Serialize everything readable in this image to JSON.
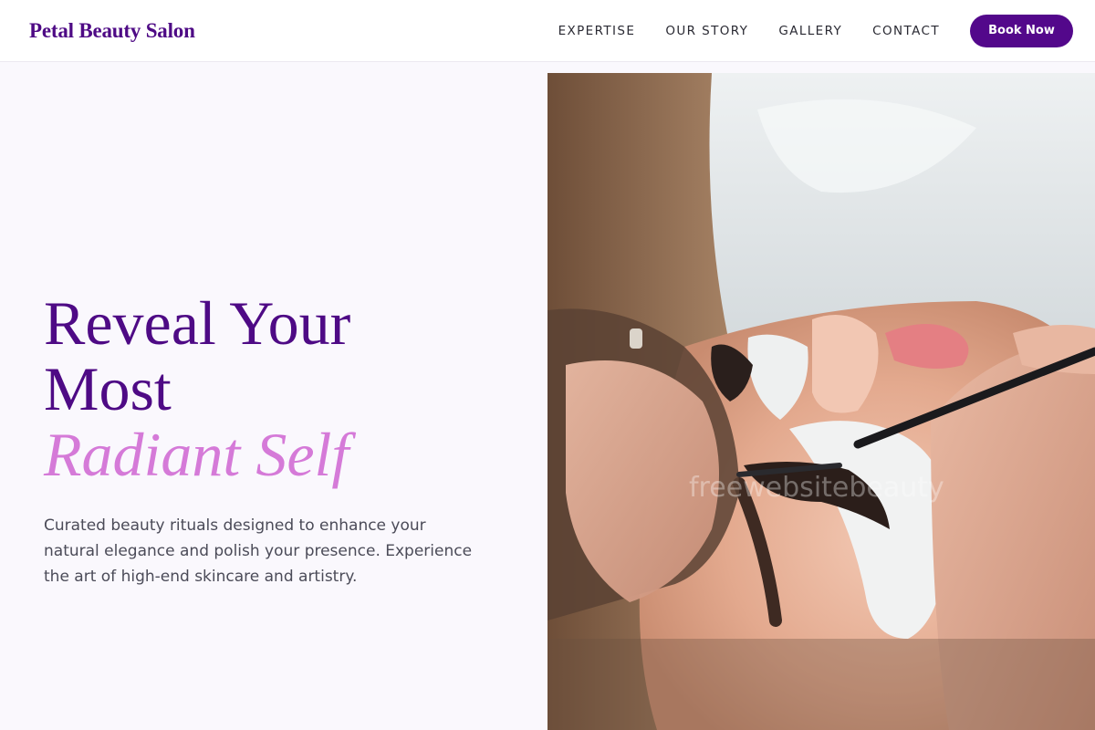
{
  "header": {
    "brand": "Petal Beauty Salon",
    "nav": [
      "EXPERTISE",
      "OUR STORY",
      "GALLERY",
      "CONTACT"
    ],
    "cta": "Book Now"
  },
  "hero": {
    "title_line1": "Reveal Your",
    "title_line2": "Most",
    "title_accent": "Radiant Self",
    "subtitle": "Curated beauty rituals designed to enhance your natural elegance and polish your presence. Experience the art of high-end skincare and artistry.",
    "image_alt": "Lash technician applying eyelash extensions to a client",
    "watermark": "freewebsitebeauty"
  },
  "colors": {
    "brand": "#4e0a85",
    "accent": "#d57ad8",
    "button": "#53088b"
  }
}
